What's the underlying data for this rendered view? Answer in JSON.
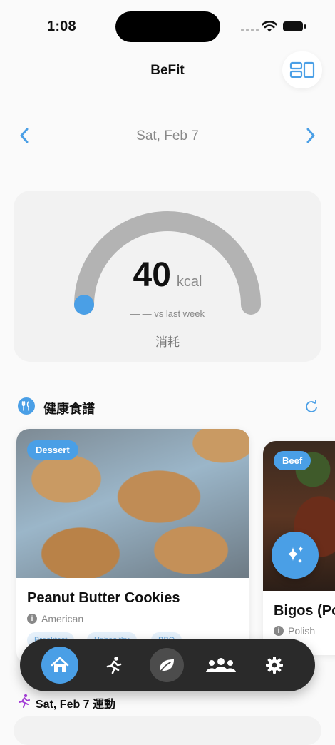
{
  "status_bar": {
    "time": "1:08"
  },
  "header": {
    "title": "BeFit"
  },
  "date_nav": {
    "date": "Sat, Feb 7"
  },
  "calories": {
    "value": "40",
    "unit": "kcal",
    "comparison": "— — vs last week",
    "label": "消耗",
    "progress_fraction": 0.0
  },
  "recipes": {
    "title": "健康食譜",
    "cards": [
      {
        "tag": "Dessert",
        "name": "Peanut Butter Cookies",
        "cuisine": "American",
        "chips": [
          "Breakfast",
          "Unhealthy",
          "BBQ"
        ]
      },
      {
        "tag": "Beef",
        "name": "Bigos (Po",
        "cuisine": "Polish"
      }
    ]
  },
  "tab_bar": {
    "tabs": [
      "home-icon",
      "running-icon",
      "leaf-icon",
      "people-icon",
      "gear-icon"
    ],
    "active": "home"
  },
  "exercise": {
    "title": "Sat, Feb 7 運動"
  },
  "colors": {
    "accent": "#4a9fe6",
    "tab_bar": "#2a2a2a",
    "gauge_track": "#b3b3b3"
  }
}
